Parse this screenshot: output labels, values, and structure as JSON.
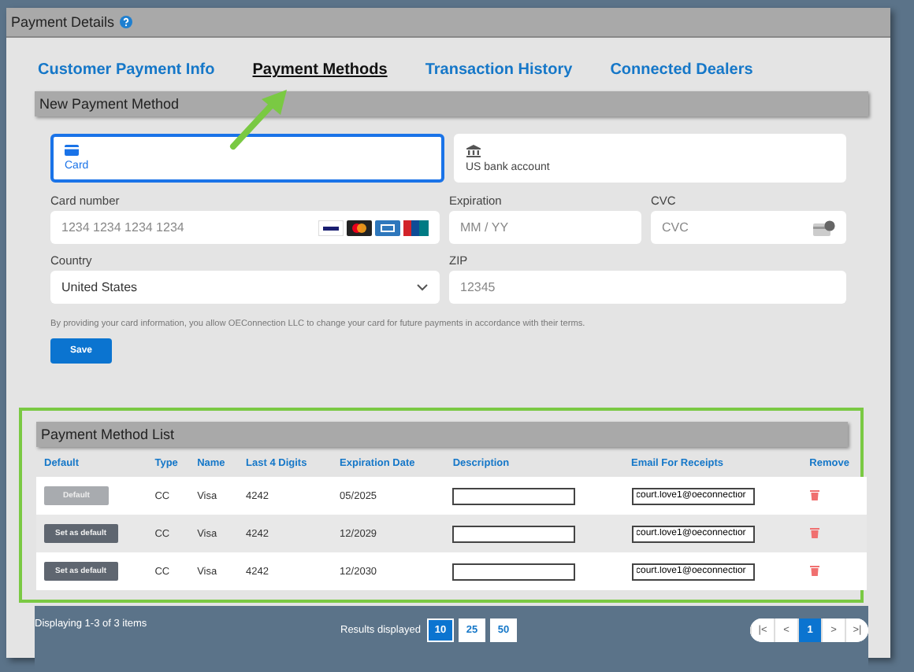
{
  "panel": {
    "title": "Payment Details"
  },
  "tabs": [
    {
      "label": "Customer Payment Info",
      "selected": false
    },
    {
      "label": "Payment Methods",
      "selected": true
    },
    {
      "label": "Transaction History",
      "selected": false
    },
    {
      "label": "Connected Dealers",
      "selected": false
    }
  ],
  "new_method": {
    "title": "New Payment Method",
    "options": [
      {
        "label": "Card",
        "kind": "card",
        "selected": true
      },
      {
        "label": "US bank account",
        "kind": "bank",
        "selected": false
      }
    ],
    "card_number": {
      "label": "Card number",
      "placeholder": "1234 1234 1234 1234"
    },
    "expiration": {
      "label": "Expiration",
      "placeholder": "MM / YY"
    },
    "cvc": {
      "label": "CVC",
      "placeholder": "CVC"
    },
    "country": {
      "label": "Country",
      "value": "United States"
    },
    "zip": {
      "label": "ZIP",
      "placeholder": "12345"
    },
    "disclaimer": "By providing your card information, you allow OEConnection LLC to change your card for future payments in accordance with their terms.",
    "save_button": "Save"
  },
  "method_list": {
    "title": "Payment Method List",
    "columns": [
      "Default",
      "Type",
      "Name",
      "Last 4 Digits",
      "Expiration Date",
      "Description",
      "Email For Receipts",
      "Remove"
    ],
    "rows": [
      {
        "default_button": "Default",
        "is_default": true,
        "type": "CC",
        "name": "Visa",
        "last4": "4242",
        "expiration": "05/2025",
        "email": "court.love1@oeconnectior"
      },
      {
        "default_button": "Set as default",
        "is_default": false,
        "type": "CC",
        "name": "Visa",
        "last4": "4242",
        "expiration": "12/2029",
        "email": "court.love1@oeconnectior"
      },
      {
        "default_button": "Set as default",
        "is_default": false,
        "type": "CC",
        "name": "Visa",
        "last4": "4242",
        "expiration": "12/2030",
        "email": "court.love1@oeconnectior"
      }
    ]
  },
  "footer": {
    "summary": "Displaying 1-3 of 3 items",
    "page_size_label": "Results displayed",
    "page_sizes": [
      {
        "label": "10",
        "selected": true
      },
      {
        "label": "25",
        "selected": false
      },
      {
        "label": "50",
        "selected": false
      }
    ],
    "pager": [
      {
        "label": "|<",
        "selected": false
      },
      {
        "label": "<",
        "selected": false
      },
      {
        "label": "1",
        "selected": true
      },
      {
        "label": ">",
        "selected": false
      },
      {
        "label": ">|",
        "selected": false
      }
    ]
  }
}
